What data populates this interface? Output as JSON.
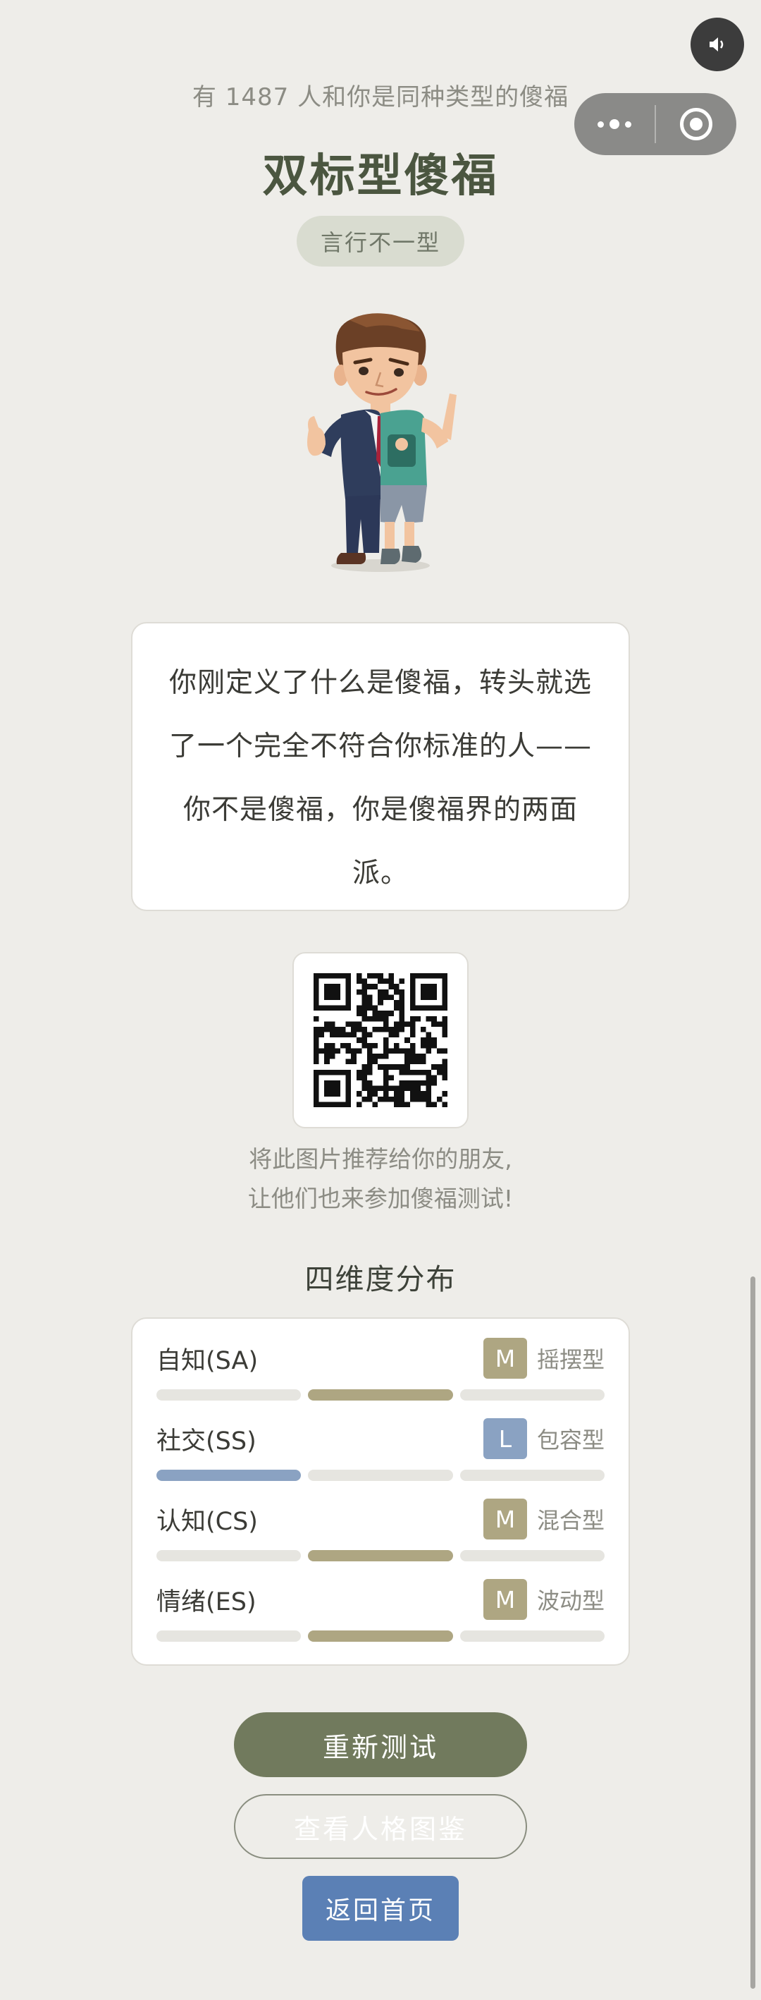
{
  "header": {
    "count_line": "有 1487 人和你是同种类型的傻福",
    "title": "双标型傻福",
    "tag": "言行不一型"
  },
  "icons": {
    "sound": "speaker-icon",
    "more": "more-dots-icon",
    "close": "miniprogram-close-icon",
    "avatar": "cartoon-avatar",
    "qr": "qr-code"
  },
  "description": "你刚定义了什么是傻福，转头就选了一个完全不符合你标准的人——你不是傻福，你是傻福界的两面派。",
  "share": {
    "line1": "将此图片推荐给你的朋友,",
    "line2": "让他们也来参加傻福测试!"
  },
  "dimensions": {
    "title": "四维度分布",
    "items": [
      {
        "label": "自知(SA)",
        "level": "M",
        "type": "摇摆型",
        "color": "#aea682",
        "active_index": 1
      },
      {
        "label": "社交(SS)",
        "level": "L",
        "type": "包容型",
        "color": "#8aa2c2",
        "active_index": 0
      },
      {
        "label": "认知(CS)",
        "level": "M",
        "type": "混合型",
        "color": "#aea682",
        "active_index": 1
      },
      {
        "label": "情绪(ES)",
        "level": "M",
        "type": "波动型",
        "color": "#aea682",
        "active_index": 1
      }
    ]
  },
  "buttons": {
    "retest": "重新测试",
    "gallery": "查看人格图鉴",
    "home": "返回首页"
  },
  "colors": {
    "background": "#eeede9",
    "title": "#4b5640",
    "primary_button": "#717a5d",
    "home_button": "#5b80b5",
    "medium_badge": "#aea682",
    "low_badge": "#8aa2c2"
  }
}
